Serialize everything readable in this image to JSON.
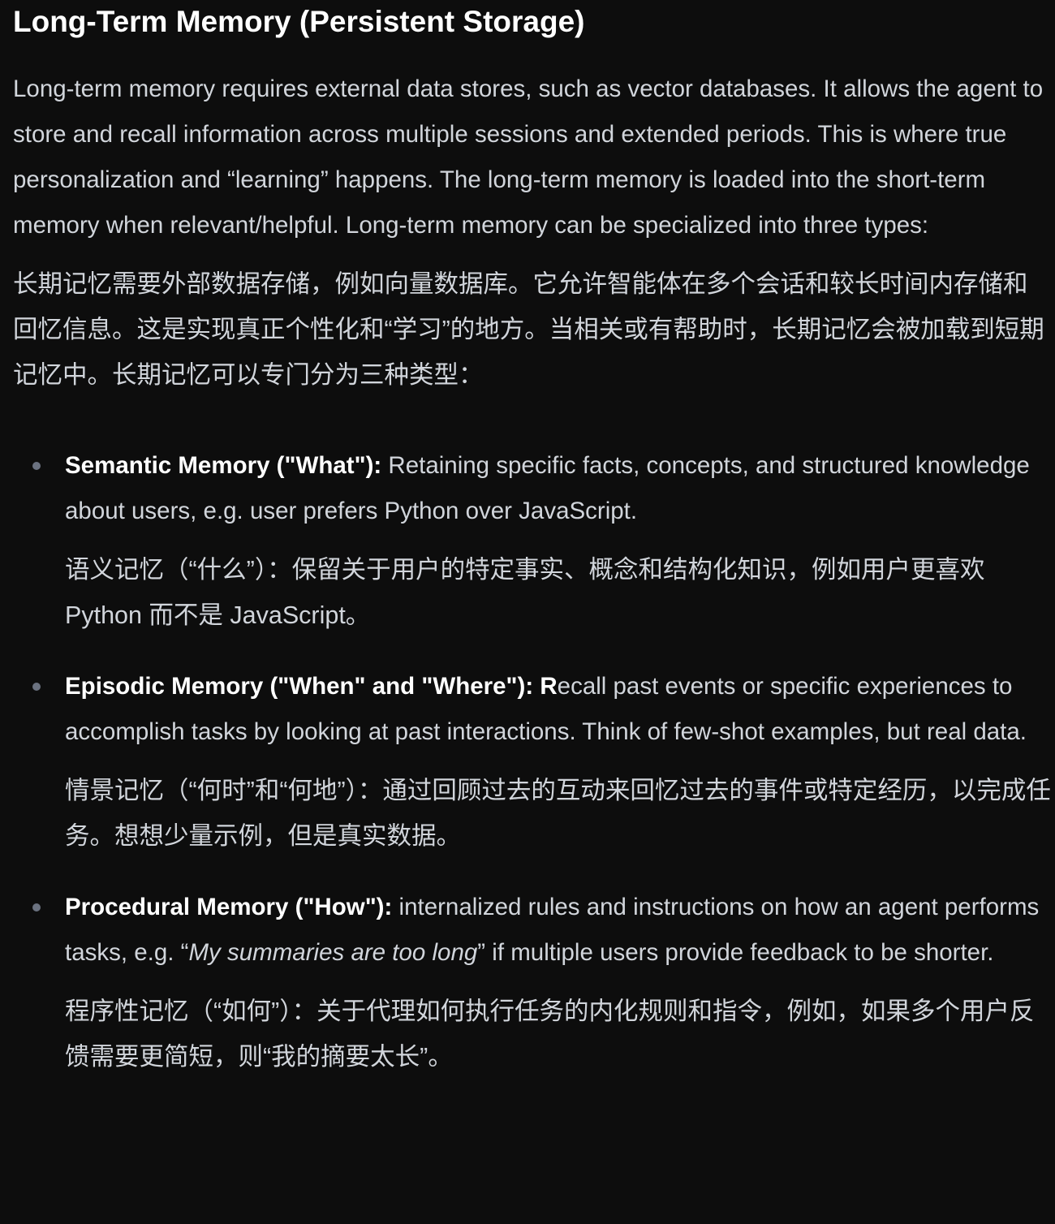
{
  "heading": "Long-Term Memory (Persistent Storage)",
  "intro_en": "Long-term memory requires external data stores, such as vector databases. It allows the agent to store and recall information across multiple sessions and extended periods. This is where true personalization and “learning” happens. The long-term memory is loaded into the short-term memory when relevant/helpful. Long-term memory can be specialized into three types:",
  "intro_zh": "长期记忆需要外部数据存储，例如向量数据库。它允许智能体在多个会话和较长时间内存储和回忆信息。这是实现真正个性化和“学习”的地方。当相关或有帮助时，长期记忆会被加载到短期记忆中。长期记忆可以专门分为三种类型：",
  "items": [
    {
      "title": "Semantic Memory (\"What\"):",
      "text": " Retaining specific facts, concepts, and structured knowledge about users, e.g. user prefers Python over JavaScript.",
      "zh": "语义记忆（“什么”）：保留关于用户的特定事实、概念和结构化知识，例如用户更喜欢 Python 而不是 JavaScript。"
    },
    {
      "title": "Episodic Memory (\"When\" and \"Where\"): R",
      "text": "ecall past events or specific experiences to accomplish tasks by looking at past interactions. Think of few-shot examples, but real data.",
      "zh": "情景记忆（“何时”和“何地”）：通过回顾过去的互动来回忆过去的事件或特定经历，以完成任务。想想少量示例，但是真实数据。"
    },
    {
      "title": "Procedural Memory (\"How\"):",
      "text": " internalized rules and instructions on how an agent performs tasks, e.g. “",
      "italic": "My summaries are too long",
      "text_after": "” if multiple users provide feedback to be shorter.",
      "zh": "程序性记忆（“如何”）：关于代理如何执行任务的内化规则和指令，例如，如果多个用户反馈需要更简短，则“我的摘要太长”。"
    }
  ]
}
